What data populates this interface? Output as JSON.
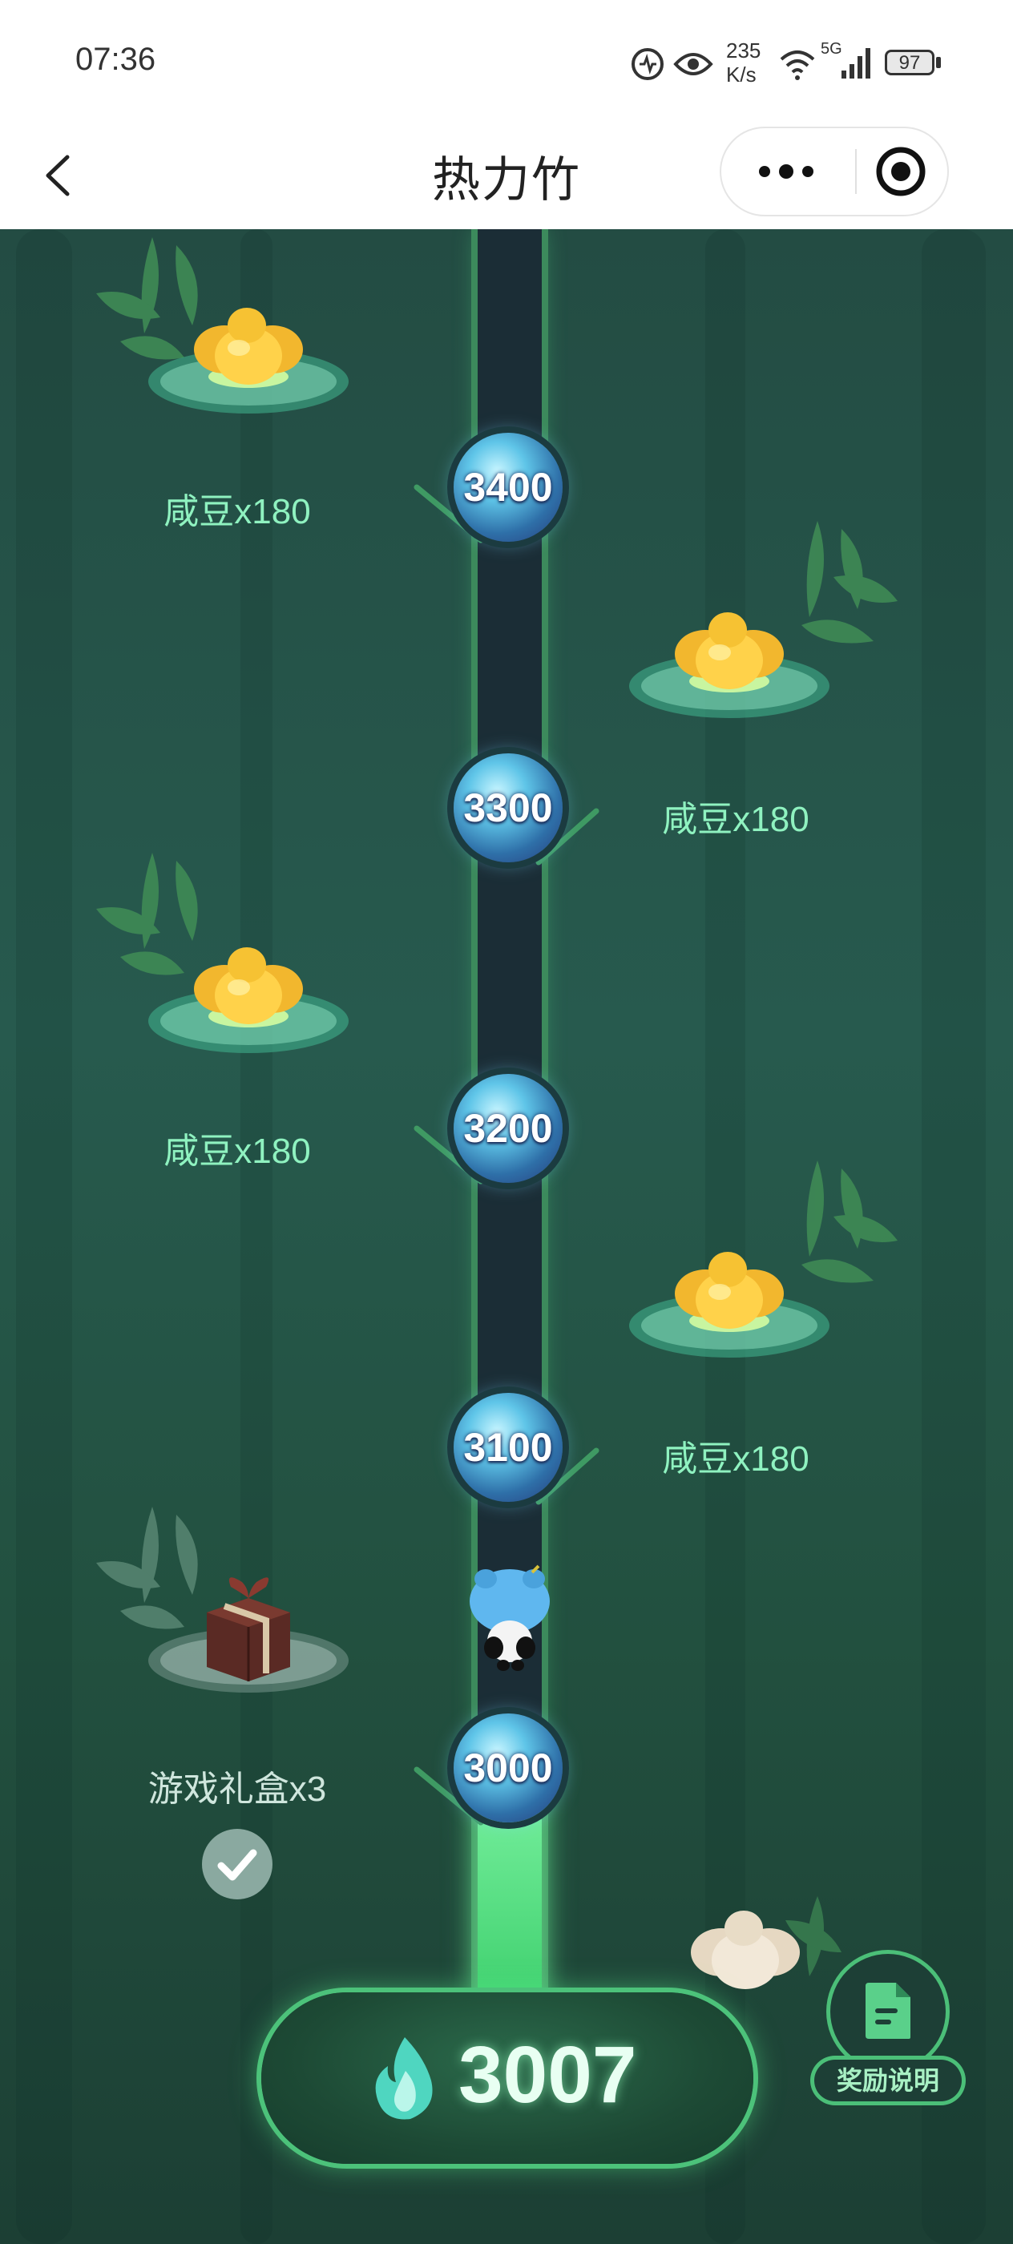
{
  "status_bar": {
    "time": "07:36",
    "net_speed_value": "235",
    "net_speed_unit": "K/s",
    "network": "5G",
    "battery": "97",
    "icons": [
      "vpn-icon",
      "eye-icon",
      "wifi-icon",
      "signal-icon",
      "battery-icon"
    ]
  },
  "nav": {
    "title": "热力竹",
    "back_icon": "chevron-left-icon",
    "more_icon": "more-dots-icon",
    "close_icon": "target-circle-icon"
  },
  "milestones": [
    {
      "value": "3400",
      "reward": "咸豆x180",
      "side": "left"
    },
    {
      "value": "3300",
      "reward": "咸豆x180",
      "side": "right"
    },
    {
      "value": "3200",
      "reward": "咸豆x180",
      "side": "left"
    },
    {
      "value": "3100",
      "reward": "咸豆x180",
      "side": "right"
    },
    {
      "value": "3000",
      "reward": "游戏礼盒x3",
      "side": "left",
      "claimed": true
    }
  ],
  "progress": {
    "current": "3007",
    "icon": "flame-icon"
  },
  "reward_info": {
    "label": "奖励说明",
    "icon": "document-icon"
  },
  "colors": {
    "background": "#275a4e",
    "accent": "#4cc27a",
    "reward_label": "#8ff2c0"
  }
}
